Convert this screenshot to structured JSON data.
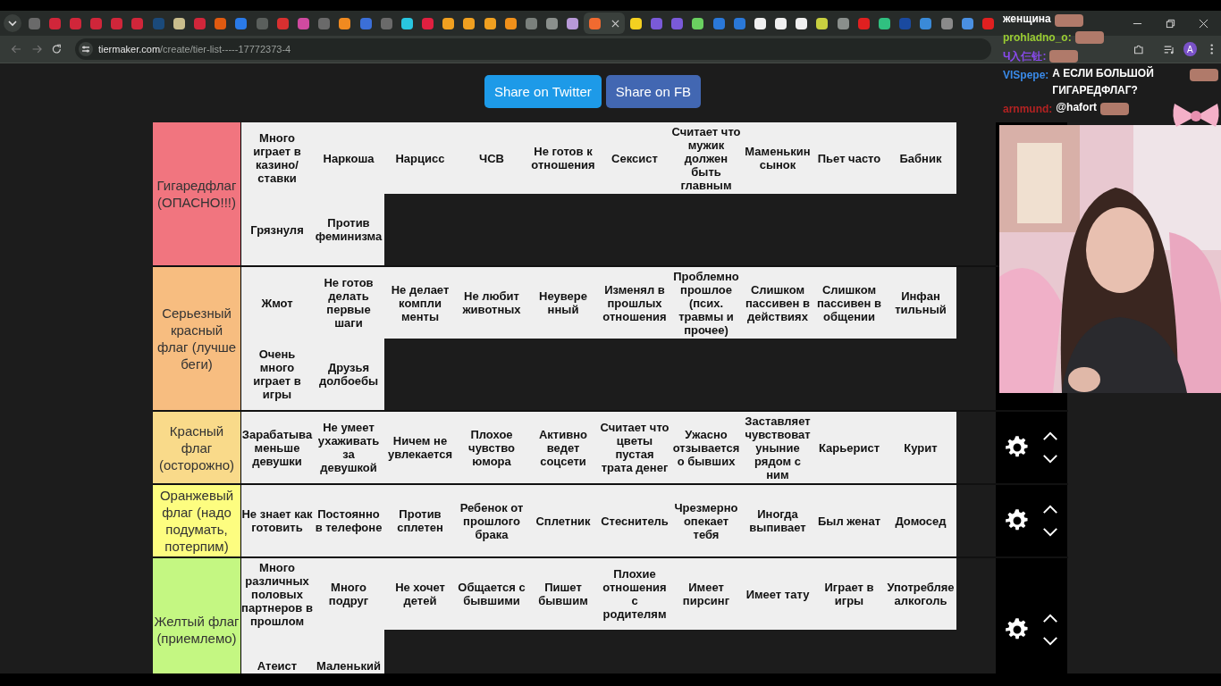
{
  "browser": {
    "tabs": [
      {
        "color": "#6a6a6a",
        "selected": false
      },
      {
        "color": "#d0263a",
        "selected": false
      },
      {
        "color": "#d0263a",
        "selected": false
      },
      {
        "color": "#d0263a",
        "selected": false
      },
      {
        "color": "#d0263a",
        "selected": false
      },
      {
        "color": "#d0263a",
        "selected": false
      },
      {
        "color": "#1b4a7a",
        "selected": false
      },
      {
        "color": "#c9bd8c",
        "selected": false
      },
      {
        "color": "#d0263a",
        "selected": false
      },
      {
        "color": "#e05a10",
        "selected": false
      },
      {
        "color": "#2a7ae8",
        "selected": false
      },
      {
        "color": "#5a5f5c",
        "selected": false
      },
      {
        "color": "#d83030",
        "selected": false
      },
      {
        "color": "#d04aa0",
        "selected": false
      },
      {
        "color": "#6a6a6a",
        "selected": false
      },
      {
        "color": "#f08a20",
        "selected": false
      },
      {
        "color": "#3b6fd8",
        "selected": false
      },
      {
        "color": "#6a6a6a",
        "selected": false
      },
      {
        "color": "#29c6e0",
        "selected": false
      },
      {
        "color": "#e02040",
        "selected": false
      },
      {
        "color": "#f0a020",
        "selected": false
      },
      {
        "color": "#f0a020",
        "selected": false
      },
      {
        "color": "#f0a020",
        "selected": false
      },
      {
        "color": "#f0901a",
        "selected": false
      },
      {
        "color": "#7a807c",
        "selected": false
      },
      {
        "color": "#8a8f8c",
        "selected": false
      },
      {
        "color": "#b89ad8",
        "selected": false
      },
      {
        "color": "#f06a30",
        "selected": true
      },
      {
        "color": "#f4d020",
        "selected": false
      },
      {
        "color": "#7a5ad8",
        "selected": false
      },
      {
        "color": "#7a5ad8",
        "selected": false
      },
      {
        "color": "#6ad060",
        "selected": false
      },
      {
        "color": "#2a78d8",
        "selected": false
      },
      {
        "color": "#2a78d8",
        "selected": false
      },
      {
        "color": "#f0f0f0",
        "selected": false
      },
      {
        "color": "#f0f0f0",
        "selected": false
      },
      {
        "color": "#f0f0f0",
        "selected": false
      },
      {
        "color": "#c8d040",
        "selected": false
      },
      {
        "color": "#8a8f8c",
        "selected": false
      },
      {
        "color": "#e02020",
        "selected": false
      },
      {
        "color": "#30c080",
        "selected": false
      },
      {
        "color": "#1a4aa0",
        "selected": false
      },
      {
        "color": "#3a8ad8",
        "selected": false
      },
      {
        "color": "#8a8a8a",
        "selected": false
      },
      {
        "color": "#4a90e2",
        "selected": false
      },
      {
        "color": "#e02020",
        "selected": false
      }
    ],
    "url_host": "tiermaker.com",
    "url_path": "/create/tier-list-----17772373-4",
    "profile_initial": "A"
  },
  "share_buttons": [
    {
      "label": "Share on Twitter",
      "kind": "twitter"
    },
    {
      "label": "Share on FB",
      "kind": "facebook"
    }
  ],
  "tiers": [
    {
      "label": "Гигаредфлаг (ОПАСНО!!!)",
      "color": "#f1757f",
      "items": [
        "Много играет в казино/ ставки",
        "Наркоша",
        "Нарцисс",
        "ЧСВ",
        "Не готов к отношения",
        "Сексист",
        "Считает что мужик должен быть главным",
        "Маменькин сынок",
        "Пьет часто",
        "Бабник",
        "Грязнуля",
        "Против феминизма"
      ]
    },
    {
      "label": "Серьезный красный флаг (лучше беги)",
      "color": "#f7bd80",
      "items": [
        "Жмот",
        "Не готов делать первые шаги",
        "Не делает компли менты",
        "Не любит животных",
        "Неувере нный",
        "Изменял в прошлых отношения",
        "Проблемно прошлое (псих. травмы и прочее)",
        "Слишком пассивен в действиях",
        "Слишком пассивен в общении",
        "Инфан тильный",
        "Очень много играет в игры",
        "Друзья долбоебы"
      ]
    },
    {
      "label": "Красный флаг (осторожно)",
      "color": "#f9da8a",
      "items": [
        "Зарабатыва меньше девушки",
        "Не умеет ухаживать за девушкой",
        "Ничем не увлекается",
        "Плохое чувство юмора",
        "Активно ведет соцсети",
        "Считает что цветы пустая трата денег",
        "Ужасно отзывается о бывших",
        "Заставляет чувствоват уныние рядом с ним",
        "Карьерист",
        "Курит"
      ]
    },
    {
      "label": "Оранжевый флаг (надо подумать, потерпим)",
      "color": "#fdfd80",
      "items": [
        "Не знает как готовить",
        "Постоянно в телефоне",
        "Против сплетен",
        "Ребенок от прошлого брака",
        "Сплетник",
        "Стеснитель",
        "Чрезмерно опекает тебя",
        "Иногда выпивает",
        "Был женат",
        "Домосед"
      ]
    },
    {
      "label": "Желтый флаг (приемлемо)",
      "color": "#c4f782",
      "items": [
        "Много различных половых партнеров в прошлом",
        "Много подруг",
        "Не хочет детей",
        "Общается с бывшими",
        "Пишет бывшим",
        "Плохие отношения с родителям",
        "Имеет пирсинг",
        "Имеет тату",
        "Играет в игры",
        "Употребляе алкоголь",
        "Атеист",
        "Маленький"
      ]
    }
  ],
  "chat": [
    {
      "text": "женщина",
      "emote": true
    },
    {
      "user": "prohladno_o:",
      "color": "#9acd32",
      "emote": true
    },
    {
      "user": "Ч入仨钍:",
      "color": "#8a4af0",
      "emote": true
    },
    {
      "user": "VISpepe:",
      "color": "#3a8ae8",
      "text": "А ЕСЛИ БОЛЬШОЙ ГИГАРЕДФЛАГ?",
      "emote": true
    },
    {
      "user": "arnmund:",
      "color": "#b22222",
      "text": "@hafort",
      "emote": true
    }
  ]
}
